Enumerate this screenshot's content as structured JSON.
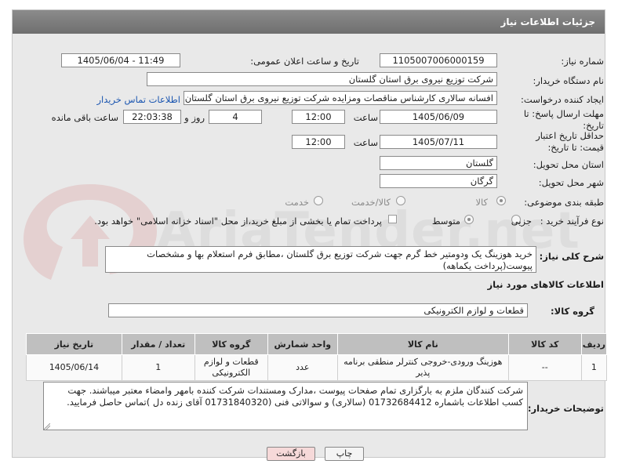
{
  "header": {
    "title": "جزئیات اطلاعات نیاز"
  },
  "form": {
    "need_number_label": "شماره نیاز:",
    "need_number": "1105007006000159",
    "announce_label": "تاریخ و ساعت اعلان عمومی:",
    "announce_value": "1405/06/04 - 11:49",
    "buyer_org_label": "نام دستگاه خریدار:",
    "buyer_org": "شرکت توزیع نیروی برق استان گلستان",
    "creator_label": "ایجاد کننده درخواست:",
    "creator": "افسانه سالاری کارشناس مناقصات ومزایده شرکت توزیع نیروی برق استان گلستان",
    "contact_link": "اطلاعات تماس خریدار",
    "reply_deadline_label": "مهلت ارسال پاسخ: تا تاریخ:",
    "reply_date": "1405/06/09",
    "time_label": "ساعت",
    "reply_time": "12:00",
    "days_value": "4",
    "days_label": "روز و",
    "remaining_time": "22:03:38",
    "remaining_label": "ساعت باقی مانده",
    "validity_label": "حداقل تاریخ اعتبار قیمت: تا تاریخ:",
    "validity_date": "1405/07/11",
    "validity_time": "12:00",
    "province_label": "استان محل تحویل:",
    "province": "گلستان",
    "city_label": "شهر محل تحویل:",
    "city": "گرگان",
    "category_label": "طبقه بندی موضوعی:",
    "category_options": [
      "کالا",
      "کالا/خدمت",
      "خدمت"
    ],
    "category_selected": "کالا",
    "process_label": "نوع فرآیند خرید :",
    "process_options": [
      "جزیی",
      "متوسط"
    ],
    "process_selected": "متوسط",
    "payment_note": "پرداخت تمام یا بخشی از مبلغ خرید،از محل \"اسناد خزانه اسلامی\" خواهد بود."
  },
  "summary": {
    "label": "شرح کلی نیاز:",
    "text": "خرید هوزینگ یک ودومتیر خط گرم جهت شرکت توزیع برق گلستان ،مطابق فرم استعلام بها و مشخصات پیوست(پرداخت یکماهه)"
  },
  "goods": {
    "section_title": "اطلاعات کالاهای مورد نیاز",
    "group_label": "گروه کالا:",
    "group_value": "قطعات و لوازم الکترونیکی",
    "columns": [
      "ردیف",
      "کد کالا",
      "نام کالا",
      "واحد شمارش",
      "گروه کالا",
      "تعداد / مقدار",
      "تاریخ نیاز"
    ],
    "rows": [
      {
        "row": "1",
        "code": "--",
        "name": "هوزینگ ورودی-خروجی کنترلر منطقی برنامه پذیر",
        "unit": "عدد",
        "group": "قطعات و لوازم الکترونیکی",
        "qty": "1",
        "date": "1405/06/14"
      }
    ]
  },
  "buyer_notes": {
    "label": "توضیحات خریدار:",
    "text": "شرکت کنندگان ملزم به بارگزاری تمام صفحات پیوست ،مدارک ومستندات شرکت کننده بامهر وامضاء معتبر میباشند. جهت کسب اطلاعات باشماره 01732684412 (سالاری) و سوالاتی فنی (01731840320 آقای زنده دل )تماس حاصل فرمایید."
  },
  "buttons": {
    "print": "چاپ",
    "back": "بازگشت"
  },
  "watermark": "AriaTender.net",
  "colors": {
    "header": "#7a7a7a",
    "link": "#1a55b0",
    "back_button": "#f6d9d9"
  }
}
